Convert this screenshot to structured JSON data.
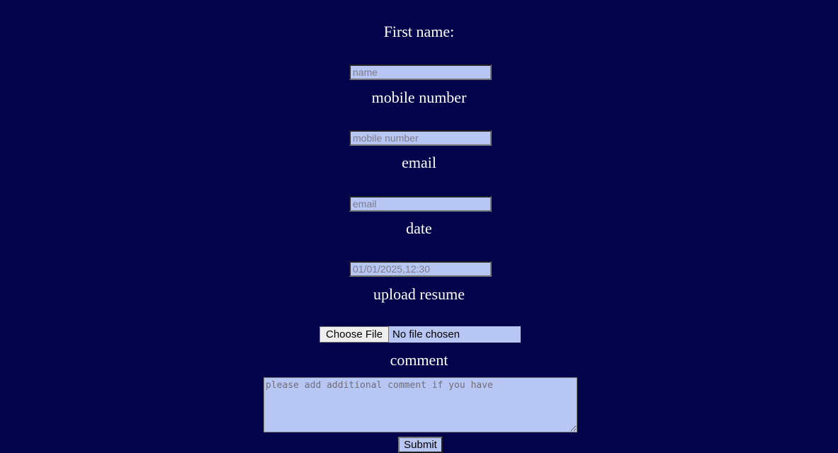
{
  "form": {
    "first_name": {
      "label": "First name:",
      "placeholder": "name"
    },
    "mobile": {
      "label": "mobile number",
      "placeholder": "mobile number"
    },
    "email": {
      "label": "email",
      "placeholder": "email"
    },
    "date": {
      "label": "date",
      "placeholder": "01/01/2025,12:30"
    },
    "resume": {
      "label": "upload resume",
      "button_label": "Choose File",
      "status": "No file chosen"
    },
    "comment": {
      "label": "comment",
      "placeholder": "please add additional comment if you have"
    },
    "submit_label": "Submit"
  },
  "colors": {
    "background": "#02034b",
    "input_background": "#b7c6f2",
    "label_text": "#ffffff"
  }
}
